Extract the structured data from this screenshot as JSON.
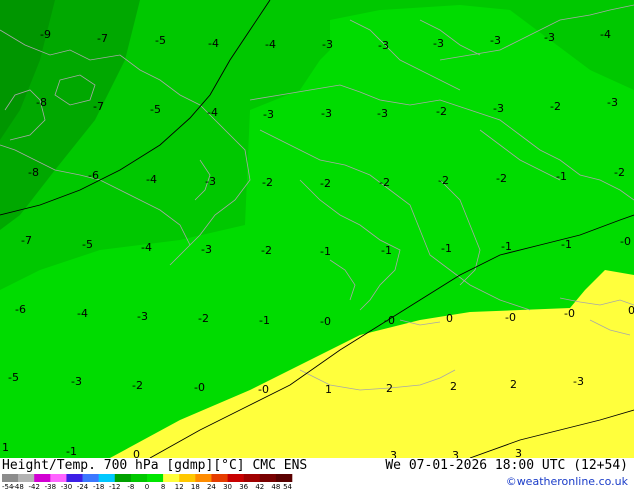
{
  "title": {
    "left": "Height/Temp. 700 hPa [gdmp][°C] CMC ENS",
    "right": "We 07-01-2026 18:00 UTC (12+54)",
    "credit": "©weatheronline.co.uk"
  },
  "legend": {
    "ticks": [
      "-54",
      "-48",
      "-42",
      "-38",
      "-30",
      "-24",
      "-18",
      "-12",
      "-8",
      "0",
      "8",
      "12",
      "18",
      "24",
      "30",
      "36",
      "42",
      "48",
      "54"
    ],
    "colors": [
      "#8c8c8c",
      "#b4b4b4",
      "#d200d2",
      "#ff64ff",
      "#3c1ee6",
      "#3c78ff",
      "#00c8ff",
      "#00a000",
      "#00c800",
      "#00e600",
      "#ffff3c",
      "#ffc800",
      "#ff8c00",
      "#e63c00",
      "#c80000",
      "#a00000",
      "#780000",
      "#5a0000"
    ]
  },
  "colors": {
    "green_dark": "#009600",
    "green_mid": "#00b400",
    "green_light": "#00dc00",
    "yellow": "#ffff3c",
    "coast": "#a0a0a0"
  },
  "values": [
    {
      "t": "-9"
    },
    {
      "t": "-7"
    },
    {
      "t": "-5"
    },
    {
      "t": "-4"
    },
    {
      "t": "-4"
    },
    {
      "t": "-3"
    },
    {
      "t": "-3"
    },
    {
      "t": "-3"
    },
    {
      "t": "-3"
    },
    {
      "t": "-3"
    },
    {
      "t": "-4"
    },
    {
      "t": "-8"
    },
    {
      "t": "-7"
    },
    {
      "t": "-5"
    },
    {
      "t": "-4"
    },
    {
      "t": "-3"
    },
    {
      "t": "-3"
    },
    {
      "t": "-3"
    },
    {
      "t": "-2"
    },
    {
      "t": "-3"
    },
    {
      "t": "-2"
    },
    {
      "t": "-3"
    },
    {
      "t": "-8"
    },
    {
      "t": "-6"
    },
    {
      "t": "-4"
    },
    {
      "t": "-3"
    },
    {
      "t": "-2"
    },
    {
      "t": "-2"
    },
    {
      "t": "-2"
    },
    {
      "t": "-2"
    },
    {
      "t": "-2"
    },
    {
      "t": "-1"
    },
    {
      "t": "-2"
    },
    {
      "t": "-7"
    },
    {
      "t": "-5"
    },
    {
      "t": "-4"
    },
    {
      "t": "-3"
    },
    {
      "t": "-2"
    },
    {
      "t": "-1"
    },
    {
      "t": "-1"
    },
    {
      "t": "-1"
    },
    {
      "t": "-1"
    },
    {
      "t": "-1"
    },
    {
      "t": "-0"
    },
    {
      "t": "-6"
    },
    {
      "t": "-4"
    },
    {
      "t": "-3"
    },
    {
      "t": "-2"
    },
    {
      "t": "-1"
    },
    {
      "t": "-0"
    },
    {
      "t": "-0"
    },
    {
      "t": "0"
    },
    {
      "t": "-0"
    },
    {
      "t": "-0"
    },
    {
      "t": "0"
    },
    {
      "t": "-5"
    },
    {
      "t": "-3"
    },
    {
      "t": "-2"
    },
    {
      "t": "-0"
    },
    {
      "t": "-0"
    },
    {
      "t": "1"
    },
    {
      "t": "1"
    },
    {
      "t": "2"
    },
    {
      "t": "2"
    },
    {
      "t": "2"
    },
    {
      "t": "-3"
    },
    {
      "t": "-1"
    },
    {
      "t": "0"
    },
    {
      "t": "3"
    },
    {
      "t": "3"
    },
    {
      "t": "3"
    }
  ]
}
